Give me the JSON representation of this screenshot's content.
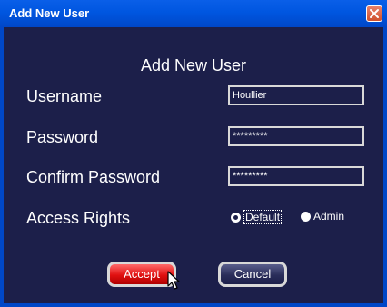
{
  "window": {
    "title": "Add New User"
  },
  "form": {
    "heading": "Add New User",
    "username": {
      "label": "Username",
      "value": "Houllier"
    },
    "password": {
      "label": "Password",
      "value": "*********"
    },
    "confirm_password": {
      "label": "Confirm Password",
      "value": "*********"
    },
    "access_rights": {
      "label": "Access Rights",
      "options": [
        "Default",
        "Admin"
      ],
      "selected": "Default"
    }
  },
  "buttons": {
    "accept_label": "Accept",
    "cancel_label": "Cancel"
  },
  "colors": {
    "titlebar": "#0056e0",
    "client_bg": "#1c1f4a",
    "accept_button": "#e01010"
  }
}
